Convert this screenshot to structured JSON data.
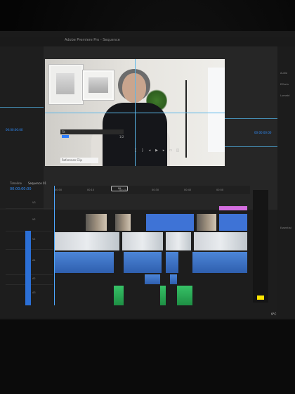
{
  "window": {
    "title": "Adobe Premiere Pro - Sequence"
  },
  "monitor": {
    "caption": "Reference Clip",
    "timecode_left": "00:00:00:00",
    "timecode_right": "00:00:00:00",
    "dropdown": "Fit",
    "zoom": "1/2"
  },
  "timeline": {
    "panel_label": "Timeline",
    "sequence_tab": "Sequence 01",
    "current_time": "00:00:00:00",
    "in_badge": "IN",
    "ruler_ticks": [
      "00:00",
      "00:10",
      "00:20",
      "00:30",
      "00:40",
      "00:50",
      "01:00"
    ],
    "tracks": [
      "V3",
      "V2",
      "V1",
      "A1",
      "A2",
      "A3"
    ]
  },
  "right_panel": {
    "items": [
      "Audio",
      "Effects",
      "Lumetri",
      "Essential"
    ]
  },
  "status_bar": {
    "text": "9°C"
  },
  "colors": {
    "accent": "#2f8fff",
    "video_clip": "#3e73d6",
    "audio_clip": "#4c86d8",
    "music_clip": "#37c267",
    "label": "#d46ee0"
  }
}
